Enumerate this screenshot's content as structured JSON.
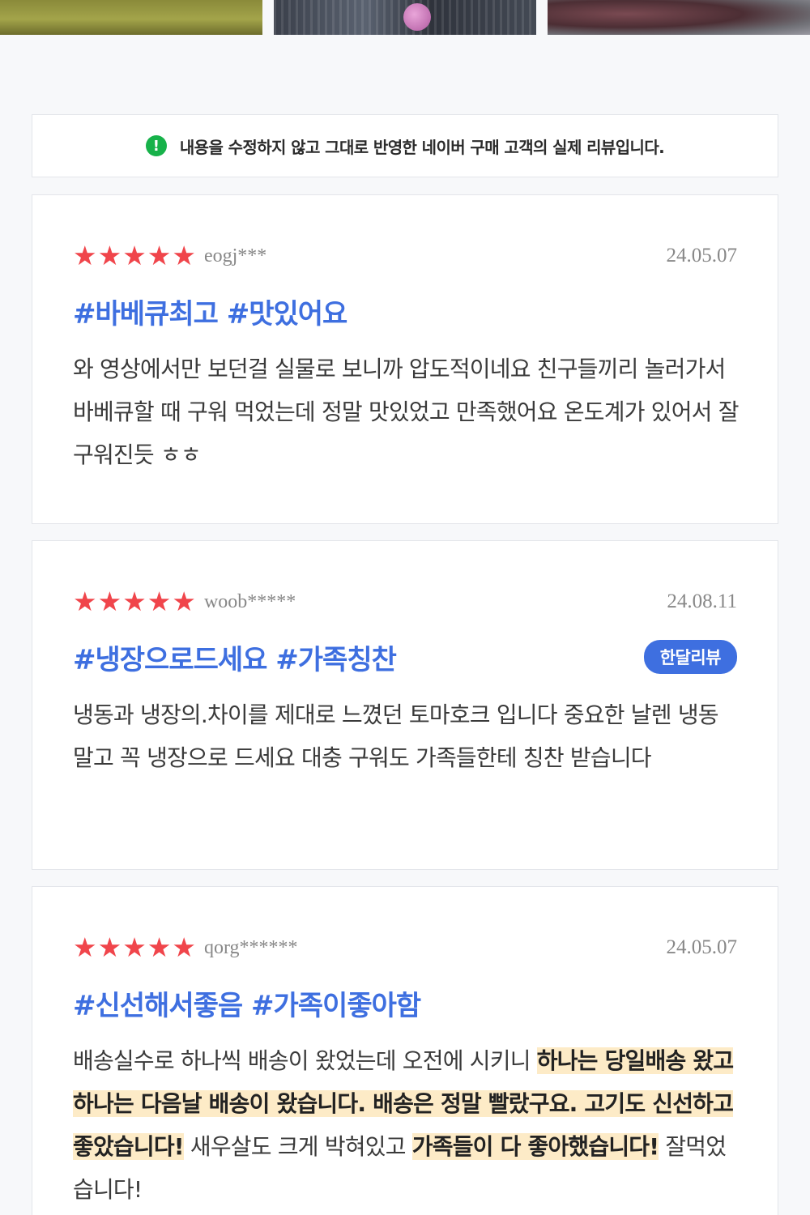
{
  "photos": [
    {
      "icon": "bbq-photo-1"
    },
    {
      "icon": "bbq-photo-2"
    },
    {
      "icon": "bbq-photo-3"
    }
  ],
  "notice": {
    "icon": "exclamation-circle-icon",
    "icon_glyph": "!",
    "icon_color": "#17b24a",
    "text": "내용을 수정하지 않고 그대로 반영한 네이버 구매 고객의 실제 리뷰입니다."
  },
  "reviews": [
    {
      "rating": 5,
      "stars": "★★★★★",
      "reviewer": "eogj***",
      "date": "24.05.07",
      "tags": "#바베큐최고 #맛있어요",
      "badge": "",
      "body": [
        {
          "text": "와 영상에서만 보던걸 실물로 보니까 압도적이네요 친구들끼리 놀러가서 바베큐할 때 구워 먹었는데 정말 맛있었고 만족했어요 온도계가 있어서 잘 구워진듯 ㅎㅎ",
          "highlight": false
        }
      ]
    },
    {
      "rating": 5,
      "stars": "★★★★★",
      "reviewer": "woob*****",
      "date": "24.08.11",
      "tags": "#냉장으로드세요 #가족칭찬",
      "badge": "한달리뷰",
      "body": [
        {
          "text": "냉동과 냉장의.차이를 제대로 느꼈던 토마호크 입니다 중요한 날렌 냉동 말고 꼭 냉장으로 드세요 대충 구워도 가족들한테 칭찬 받습니다",
          "highlight": false
        }
      ]
    },
    {
      "rating": 5,
      "stars": "★★★★★",
      "reviewer": "qorg******",
      "date": "24.05.07",
      "tags": "#신선해서좋음 #가족이좋아함",
      "badge": "",
      "body": [
        {
          "text": "배송실수로 하나씩 배송이 왔었는데 오전에 시키니 ",
          "highlight": false
        },
        {
          "text": "하나는 당일배송 왔고 하나는 다음날 배송이 왔습니다. 배송은 정말 빨랐구요. 고기도 신선하고 좋았습니다!",
          "highlight": true
        },
        {
          "text": " 새우살도 크게 박혀있고 ",
          "highlight": false
        },
        {
          "text": "가족들이 다 좋아했습니다!",
          "highlight": true
        },
        {
          "text": " 잘먹었습니다!",
          "highlight": false
        }
      ]
    }
  ],
  "colors": {
    "star": "#f0454b",
    "tag": "#3e6fe0",
    "badge_bg": "#3e6fe0",
    "highlight": "#fdebc7",
    "page_bg": "#f7f8fa"
  }
}
